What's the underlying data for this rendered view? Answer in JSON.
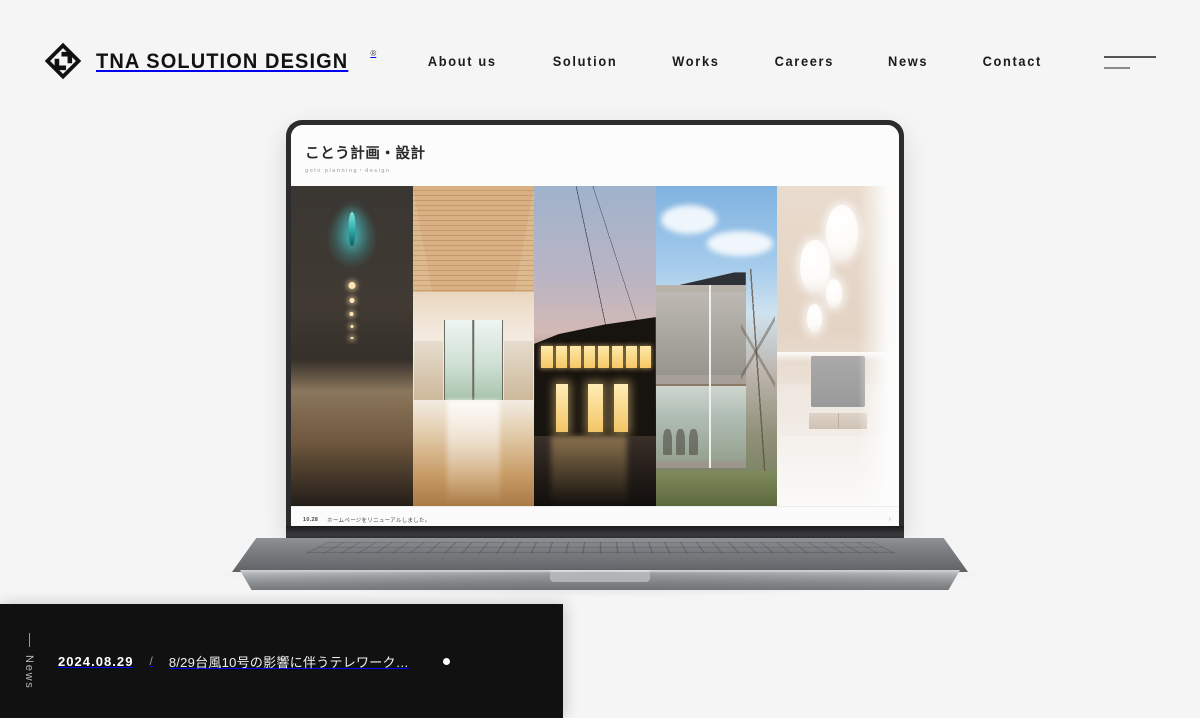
{
  "header": {
    "brand": {
      "name": "TNA SOLUTION DESIGN",
      "registered_mark": "®",
      "logo_icon": "tna-diamond-logo-icon"
    },
    "nav": [
      {
        "label": "About us"
      },
      {
        "label": "Solution"
      },
      {
        "label": "Works"
      },
      {
        "label": "Careers"
      },
      {
        "label": "News"
      },
      {
        "label": "Contact"
      }
    ],
    "menu_toggle_icon": "hamburger-menu-icon"
  },
  "hero": {
    "device": "laptop-mockup",
    "screen": {
      "site_title": "ことう計画・設計",
      "site_subtitle": "goto planning・design",
      "gallery": [
        {
          "caption": "dark corridor interior with teal pendant light"
        },
        {
          "caption": "wood ceiling hall with glass entrance"
        },
        {
          "caption": "dusk exterior with illuminated windows"
        },
        {
          "caption": "two-storey building exterior under blue sky"
        },
        {
          "caption": "bright interior render with pendant lamps"
        }
      ],
      "ticker": {
        "date": "10.28",
        "text": "ホームページをリニューアルしました。",
        "arrow_icon": "chevron-right-icon"
      }
    }
  },
  "news_bar": {
    "vertical_label": "News",
    "vertical_dash": "—",
    "item": {
      "date": "2024.08.29",
      "separator": "/",
      "title": "8/29台風10号の影響に伴うテレワーク…",
      "indicator_icon": "active-dot-icon"
    }
  },
  "colors": {
    "page_bg": "#f5f5f5",
    "news_bar_bg": "#111111",
    "text_dark": "#1b1b1b",
    "text_light": "#ffffff",
    "accent_muted": "#9a9a9a"
  }
}
